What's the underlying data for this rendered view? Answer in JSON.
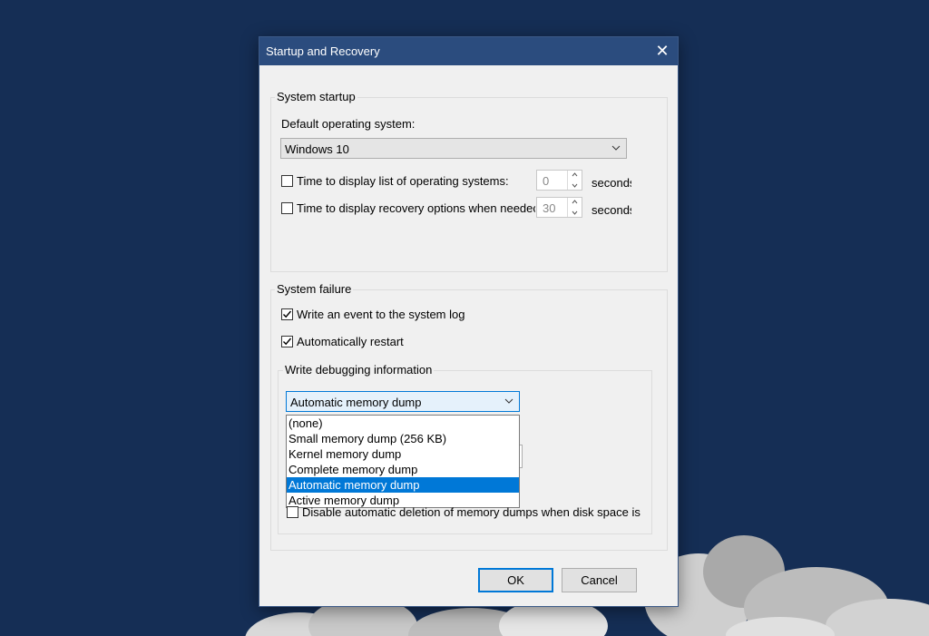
{
  "dialog": {
    "title": "Startup and Recovery",
    "close_glyph": "✕"
  },
  "system_startup": {
    "group_title": "System startup",
    "default_os_label": "Default operating system:",
    "default_os_value": "Windows 10",
    "display_list": {
      "label": "Time to display list of operating systems:",
      "checked": false,
      "value": "0",
      "unit": "seconds"
    },
    "display_recovery": {
      "label": "Time to display recovery options when needec",
      "checked": false,
      "value": "30",
      "unit": "seconds"
    }
  },
  "system_failure": {
    "group_title": "System failure",
    "write_event": {
      "label": "Write an event to the system log",
      "checked": true
    },
    "auto_restart": {
      "label": "Automatically restart",
      "checked": true
    },
    "debug_group_title": "Write debugging information",
    "dump_select_value": "Automatic memory dump",
    "dump_options": [
      "(none)",
      "Small memory dump (256 KB)",
      "Kernel memory dump",
      "Complete memory dump",
      "Automatic memory dump",
      "Active memory dump"
    ],
    "selected_option_index": 4,
    "disable_auto_delete": {
      "label": "Disable automatic deletion of memory dumps when disk space is l",
      "checked": false
    }
  },
  "buttons": {
    "ok": "OK",
    "cancel": "Cancel"
  },
  "colors": {
    "desktop_background": "#152e55",
    "titlebar": "#2b4c7e",
    "selection": "#0078d7"
  }
}
